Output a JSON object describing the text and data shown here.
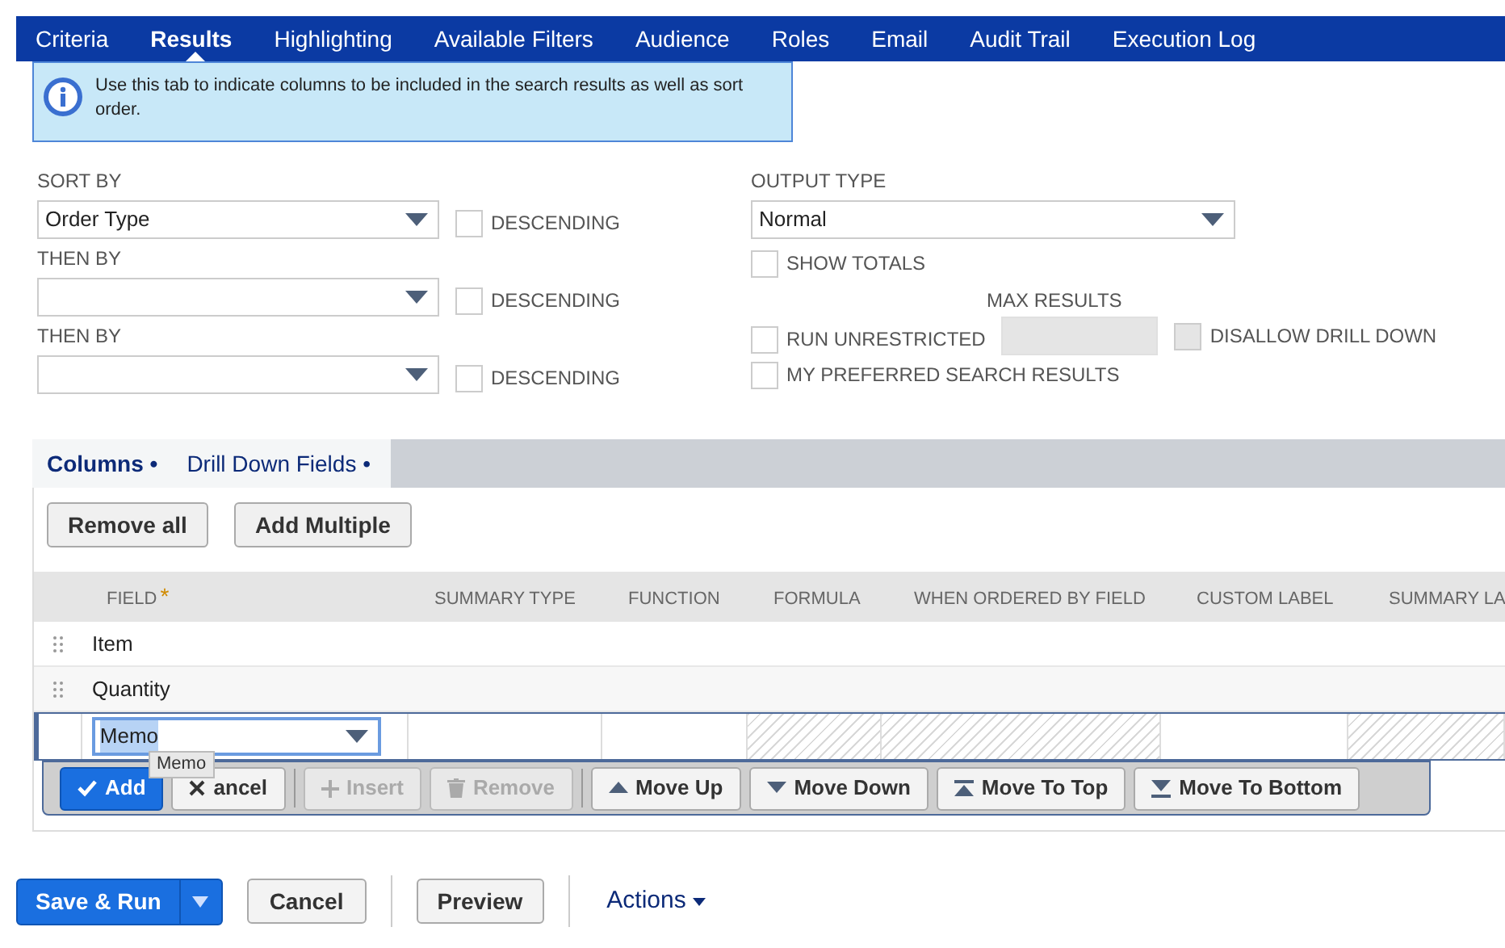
{
  "tabs": [
    {
      "label": "Criteria",
      "selected": false
    },
    {
      "label": "Results",
      "selected": true
    },
    {
      "label": "Highlighting",
      "selected": false
    },
    {
      "label": "Available Filters",
      "selected": false
    },
    {
      "label": "Audience",
      "selected": false
    },
    {
      "label": "Roles",
      "selected": false
    },
    {
      "label": "Email",
      "selected": false
    },
    {
      "label": "Audit Trail",
      "selected": false
    },
    {
      "label": "Execution Log",
      "selected": false
    }
  ],
  "info": "Use this tab to indicate columns to be included in the search results as well as sort order.",
  "sort_fields": [
    {
      "label": "SORT BY",
      "value": "Order Type",
      "descending_label": "DESCENDING",
      "descending": false
    },
    {
      "label": "THEN BY",
      "descending_label": "DESCENDING",
      "descending": false
    },
    {
      "label": "THEN BY",
      "descending_label": "DESCENDING",
      "descending": false
    }
  ],
  "output_type": {
    "label": "OUTPUT TYPE",
    "value": "Normal"
  },
  "show_totals": {
    "label": "SHOW TOTALS",
    "checked": false
  },
  "max_results": {
    "label": "MAX RESULTS",
    "disabled": true
  },
  "run_unrestricted": {
    "label": "RUN UNRESTRICTED",
    "checked": false
  },
  "disallow_drill_down": {
    "label": "DISALLOW DRILL DOWN",
    "checked": false,
    "disabled": true
  },
  "my_preferred": {
    "label": "MY PREFERRED SEARCH RESULTS",
    "checked": false
  },
  "subtabs": [
    {
      "label": "Columns •",
      "selected": true
    },
    {
      "label": "Drill Down Fields •",
      "selected": false
    }
  ],
  "list_buttons": [
    "Remove all",
    "Add Multiple"
  ],
  "table": {
    "columns": [
      "FIELD",
      "SUMMARY TYPE",
      "FUNCTION",
      "FORMULA",
      "WHEN ORDERED BY FIELD",
      "CUSTOM LABEL",
      "SUMMARY LA"
    ],
    "required_mark": "*",
    "rows": [
      {
        "field": "Item"
      },
      {
        "field": "Quantity"
      }
    ],
    "edit_row": {
      "field": "Memo",
      "hatched": [
        false,
        false,
        true,
        true,
        false,
        true
      ]
    }
  },
  "tooltip": "Memo",
  "row_buttons": [
    {
      "kind": "primary",
      "label": "Add",
      "disabled": false
    },
    {
      "kind": "normal",
      "label": "ancel",
      "disabled": false
    },
    {
      "kind": "normal",
      "label": "Insert",
      "disabled": true
    },
    {
      "kind": "normal",
      "label": "Remove",
      "disabled": true
    },
    {
      "kind": "normal",
      "label": "Move Up",
      "disabled": false
    },
    {
      "kind": "normal",
      "label": "Move Down",
      "disabled": false
    },
    {
      "kind": "normal",
      "label": "Move To Top",
      "disabled": false
    },
    {
      "kind": "normal",
      "label": "Move To Bottom",
      "disabled": false
    }
  ],
  "footer": {
    "save": "Save & Run",
    "cancel": "Cancel",
    "preview": "Preview",
    "actions": "Actions"
  }
}
